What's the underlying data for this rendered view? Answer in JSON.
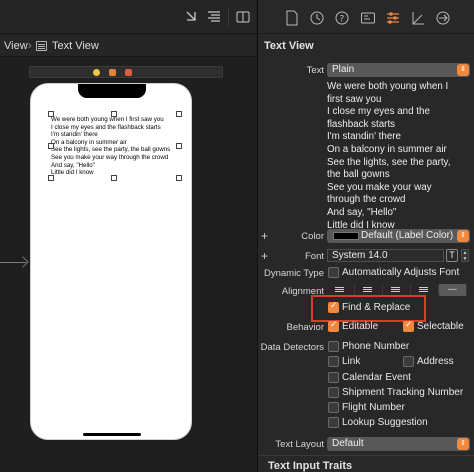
{
  "colors": {
    "accent": "#f0883e",
    "highlight_border": "#e03a2b",
    "panel_bg": "#282828",
    "canvas_bg": "#1f1f1f",
    "device_screen": "#ffffff"
  },
  "canvas": {
    "breadcrumb": [
      "View",
      "Text View"
    ],
    "toolbar_icons": [
      "add-editor-icon",
      "align-lines-icon",
      "split-editor-icon"
    ],
    "scene_dots": [
      {
        "icon": "view-controller-icon",
        "color": "#f2c744"
      },
      {
        "icon": "first-responder-icon",
        "color": "#e8803a"
      },
      {
        "icon": "exit-icon",
        "color": "#e45c3a"
      }
    ],
    "text_view_lines": [
      "We were both young when I first saw you",
      "I close my eyes and the flashback starts",
      "I'm standin' there",
      "On a balcony in summer air",
      "See the lights, see the party, the ball gowns",
      "See you make your way through the crowd",
      "And say, \"Hello\"",
      "Little did I know"
    ]
  },
  "inspector": {
    "tab_icons": [
      "file-icon",
      "history-icon",
      "help-icon",
      "identity-icon",
      "attributes-icon",
      "size-icon",
      "connections-icon"
    ],
    "section_title": "Text View",
    "text": {
      "label": "Text",
      "value": "Plain"
    },
    "text_content_lines": [
      "We were both young when I",
      "first saw you",
      "I close my eyes and the",
      "flashback starts",
      "I'm standin' there",
      "On a balcony in summer air",
      "See the lights, see the party,",
      "the ball gowns",
      "See you make your way",
      "through the crowd",
      "And say, \"Hello\"",
      "Little did I know"
    ],
    "color": {
      "label": "Color",
      "value": "Default (Label Color)"
    },
    "font": {
      "label": "Font",
      "value": "System 14.0",
      "glyph": "T"
    },
    "dynamic_type": {
      "label": "Dynamic Type",
      "option": "Automatically Adjusts Font",
      "checked": false
    },
    "alignment": {
      "label": "Alignment",
      "options": [
        "left",
        "center",
        "right",
        "justified"
      ],
      "natural_label": "---"
    },
    "find_replace": {
      "label": "Find & Replace",
      "checked": true
    },
    "behavior": {
      "label": "Behavior",
      "editable": "Editable",
      "editable_checked": true,
      "selectable": "Selectable",
      "selectable_checked": true
    },
    "data_detectors": {
      "label": "Data Detectors",
      "items": [
        {
          "label": "Phone Number",
          "checked": false
        },
        {
          "label": "Link",
          "checked": false
        },
        {
          "label": "Address",
          "checked": false
        },
        {
          "label": "Calendar Event",
          "checked": false
        },
        {
          "label": "Shipment Tracking Number",
          "checked": false
        },
        {
          "label": "Flight Number",
          "checked": false
        },
        {
          "label": "Lookup Suggestion",
          "checked": false
        }
      ]
    },
    "text_layout": {
      "label": "Text Layout",
      "value": "Default"
    },
    "next_section_title": "Text Input Traits"
  }
}
